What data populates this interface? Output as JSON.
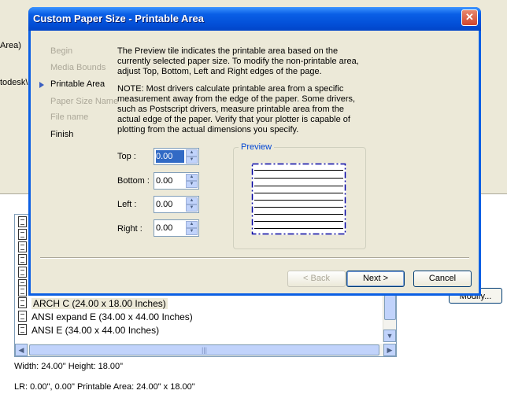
{
  "background": {
    "area_fragment": "Area)",
    "path_fragment": "todesk\\",
    "paper_list": [
      {
        "label": ""
      },
      {
        "label": ""
      },
      {
        "label": ""
      },
      {
        "label": ""
      },
      {
        "label": ""
      },
      {
        "label": ""
      },
      {
        "label": ""
      },
      {
        "label": "ARCH C (24.00 x 18.00 Inches)",
        "selected": true
      },
      {
        "label": "ANSI expand E (34.00 x 44.00 Inches)"
      },
      {
        "label": "ANSI E (34.00 x 44.00 Inches)"
      }
    ],
    "modify_label": "Modify...",
    "size_info": "Width: 24.00\"  Height: 18.00\"",
    "area_info": "LR: 0.00\", 0.00\"  Printable Area: 24.00\" x 18.00\""
  },
  "dialog": {
    "title": "Custom Paper Size - Printable Area",
    "close_glyph": "✕",
    "steps": [
      "Begin",
      "Media Bounds",
      "Printable Area",
      "Paper Size Name",
      "File name",
      "Finish"
    ],
    "current_step": 2,
    "intro_text": "The Preview tile indicates the printable area based on the currently selected paper size. To modify the non-printable area, adjust Top, Bottom, Left and Right edges of the page.",
    "note_text": "NOTE: Most drivers calculate printable area from a specific measurement away from the edge of the paper. Some drivers, such as Postscript drivers, measure printable area from the actual edge of the paper. Verify that your plotter is capable of plotting from the actual dimensions you specify.",
    "fields": {
      "top": {
        "label": "Top :",
        "value": "0.00"
      },
      "bottom": {
        "label": "Bottom :",
        "value": "0.00"
      },
      "left": {
        "label": "Left :",
        "value": "0.00"
      },
      "right": {
        "label": "Right :",
        "value": "0.00"
      }
    },
    "preview_label": "Preview",
    "buttons": {
      "back": "< Back",
      "next": "Next >",
      "cancel": "Cancel"
    }
  },
  "colors": {
    "title_bar": "#0a5fe6",
    "dialog_face": "#ece9d8",
    "preview_border": "#0000a0"
  }
}
